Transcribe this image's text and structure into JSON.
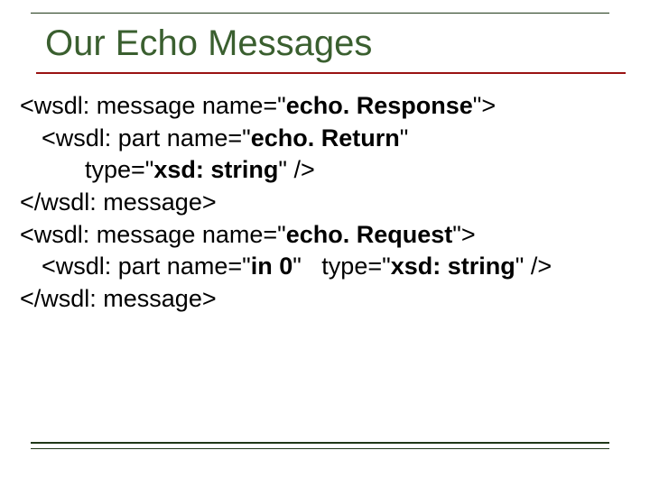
{
  "title": "Our Echo Messages",
  "code": {
    "l1a": "<wsdl: message name=\"",
    "l1b": "echo. Response",
    "l1c": "\">",
    "l2a": "<wsdl: part name=\"",
    "l2b": "echo. Return",
    "l2c": "\"",
    "l3a": "type=\"",
    "l3b": "xsd: string",
    "l3c": "\" />",
    "l4": "</wsdl: message>",
    "l5a": "<wsdl: message name=\"",
    "l5b": "echo. Request",
    "l5c": "\">",
    "l6a": "<wsdl: part name=\"",
    "l6b": "in 0",
    "l6c": "\"   type=\"",
    "l6d": "xsd: string",
    "l6e": "\" />",
    "l7": "</wsdl: message>"
  }
}
